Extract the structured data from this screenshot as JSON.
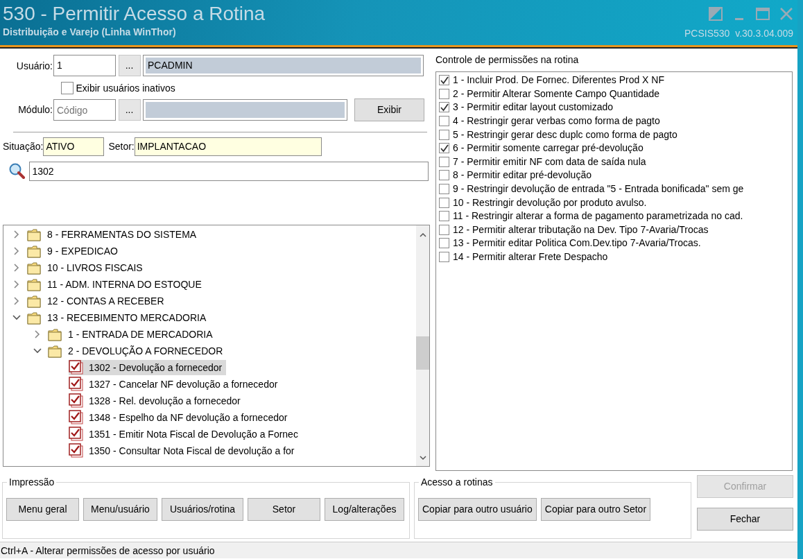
{
  "window": {
    "title": "530 - Permitir Acesso a Rotina",
    "subtitle": "Distribuição e Varejo (Linha WinThor)",
    "version": "PCSIS530  v.30.3.04.009"
  },
  "user": {
    "label": "Usuário:",
    "code": "1",
    "lookup": "...",
    "name": "PCADMIN"
  },
  "show_inactive": {
    "label": "Exibir usuários inativos",
    "checked": false
  },
  "module": {
    "label": "Módulo:",
    "placeholder": "Código",
    "lookup": "...",
    "button": "Exibir"
  },
  "situation": {
    "label": "Situação:",
    "value": "ATIVO"
  },
  "sector": {
    "label": "Setor:",
    "value": "IMPLANTACAO"
  },
  "search": {
    "value": "1302"
  },
  "tree": [
    {
      "kind": "folder",
      "label": "8 - FERRAMENTAS DO SISTEMA",
      "expanded": false
    },
    {
      "kind": "folder",
      "label": "9 - EXPEDICAO",
      "expanded": false
    },
    {
      "kind": "folder",
      "label": "10 - LIVROS FISCAIS",
      "expanded": false
    },
    {
      "kind": "folder",
      "label": "11 - ADM. INTERNA DO ESTOQUE",
      "expanded": false
    },
    {
      "kind": "folder",
      "label": "12 - CONTAS A RECEBER",
      "expanded": false
    },
    {
      "kind": "folder",
      "label": "13 - RECEBIMENTO MERCADORIA",
      "expanded": true,
      "children": [
        {
          "kind": "folder",
          "label": "1 - ENTRADA DE MERCADORIA",
          "expanded": false
        },
        {
          "kind": "folder",
          "label": "2 - DEVOLUÇÃO A FORNECEDOR",
          "expanded": true,
          "children": [
            {
              "kind": "routine",
              "label": "1302 - Devolução a fornecedor",
              "checked": true,
              "selected": true
            },
            {
              "kind": "routine",
              "label": "1327 - Cancelar NF devolução a fornecedor",
              "checked": true,
              "selected": false
            },
            {
              "kind": "routine",
              "label": "1328 - Rel. devolução a fornecedor",
              "checked": true,
              "selected": false
            },
            {
              "kind": "routine",
              "label": "1348 - Espelho da NF devolução a fornecedor",
              "checked": true,
              "selected": false
            },
            {
              "kind": "routine",
              "label": "1351 - Emitir Nota Fiscal de Devolução a Fornec",
              "checked": true,
              "selected": false
            },
            {
              "kind": "routine",
              "label": "1350 - Consultar Nota Fiscal de devolução a for",
              "checked": true,
              "selected": false
            }
          ]
        }
      ]
    }
  ],
  "permissions": {
    "title": "Controle de permissões na rotina",
    "items": [
      {
        "label": "1 - Incluir Prod. De Fornec. Diferentes Prod X NF",
        "checked": true
      },
      {
        "label": "2 - Permitir Alterar Somente Campo Quantidade",
        "checked": false
      },
      {
        "label": "3 - Permitir editar layout customizado",
        "checked": true
      },
      {
        "label": "4 - Restringir gerar verbas como forma de pagto",
        "checked": false
      },
      {
        "label": "5 - Restringir gerar desc duplc como forma de pagto",
        "checked": false
      },
      {
        "label": "6 - Permitir somente carregar pré-devolução",
        "checked": true
      },
      {
        "label": "7 - Permitir emitir NF com data de saída nula",
        "checked": false
      },
      {
        "label": "8 - Permitir editar pré-devolução",
        "checked": false
      },
      {
        "label": "9 - Restringir devolução de entrada \"5 - Entrada bonificada\" sem ge",
        "checked": false
      },
      {
        "label": "10 - Restringir devolução por produto avulso.",
        "checked": false
      },
      {
        "label": "11 - Restringir alterar a forma de pagamento parametrizada no cad.",
        "checked": false
      },
      {
        "label": "12 - Permitir alterar tributação na Dev. Tipo 7-Avaria/Trocas",
        "checked": false
      },
      {
        "label": "13 - Permitir editar Politica Com.Dev.tipo 7-Avaria/Trocas.",
        "checked": false
      },
      {
        "label": "14 - Permitir alterar Frete Despacho",
        "checked": false
      }
    ]
  },
  "print_group": {
    "title": "Impressão",
    "buttons": [
      "Menu geral",
      "Menu/usuário",
      "Usuários/rotina",
      "Setor",
      "Log/alterações"
    ]
  },
  "access_group": {
    "title": "Acesso a rotinas",
    "buttons": [
      "Copiar para outro usuário",
      "Copiar para outro Setor"
    ]
  },
  "actions": [
    {
      "label": "Confirmar",
      "disabled": true
    },
    {
      "label": "Fechar",
      "disabled": false
    }
  ],
  "status_bar": "Ctrl+A - Alterar permissões de acesso por usuário"
}
